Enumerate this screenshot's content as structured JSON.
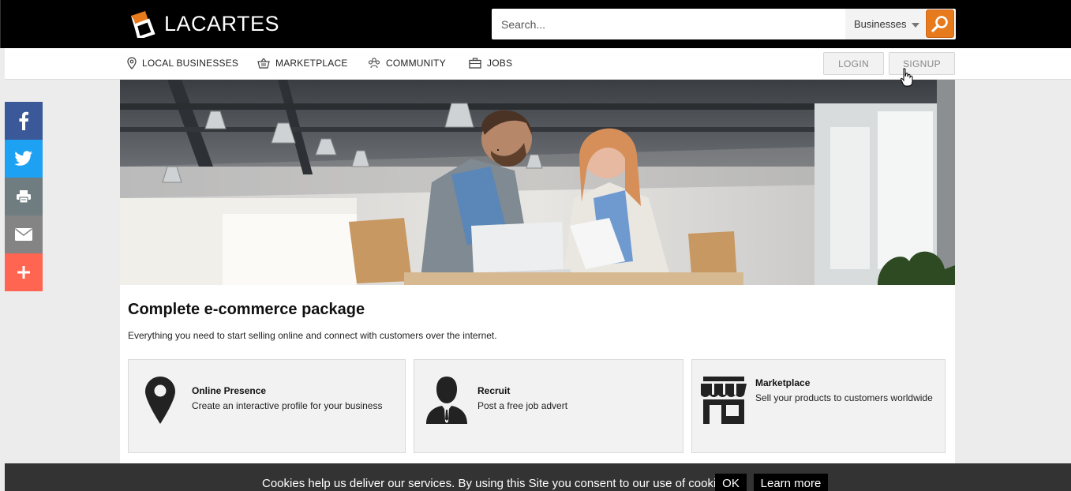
{
  "header": {
    "logo_text": "LACARTES",
    "search_placeholder": "Search...",
    "search_category": "Businesses",
    "colors": {
      "accent": "#e87a1e",
      "topbar": "#000000"
    }
  },
  "nav": {
    "items": [
      {
        "label": "LOCAL BUSINESSES",
        "icon": "map-pin-icon"
      },
      {
        "label": "MARKETPLACE",
        "icon": "basket-icon"
      },
      {
        "label": "COMMUNITY",
        "icon": "community-icon"
      },
      {
        "label": "JOBS",
        "icon": "briefcase-icon"
      }
    ],
    "login_label": "LOGIN",
    "signup_label": "SIGNUP"
  },
  "social": [
    {
      "name": "facebook-icon",
      "color": "#3b5998"
    },
    {
      "name": "twitter-icon",
      "color": "#1da1f2"
    },
    {
      "name": "print-icon",
      "color": "#6f7d80"
    },
    {
      "name": "email-icon",
      "color": "#848484"
    },
    {
      "name": "plus-icon",
      "color": "#ff6550"
    }
  ],
  "main": {
    "title": "Complete e-commerce package",
    "subtitle": "Everything you need to start selling online and connect with customers over the internet.",
    "cards": [
      {
        "title": "Online Presence",
        "desc": "Create an interactive profile for your business",
        "icon": "location-pin-icon"
      },
      {
        "title": "Recruit",
        "desc": "Post a free job advert",
        "icon": "businessman-icon"
      },
      {
        "title": "Marketplace",
        "desc": "Sell your products to customers worldwide",
        "icon": "storefront-icon"
      }
    ]
  },
  "cookie": {
    "text": "Cookies help us deliver our services. By using this Site you consent to our use of cookies.",
    "ok_label": "OK",
    "learn_more_label": "Learn more"
  }
}
